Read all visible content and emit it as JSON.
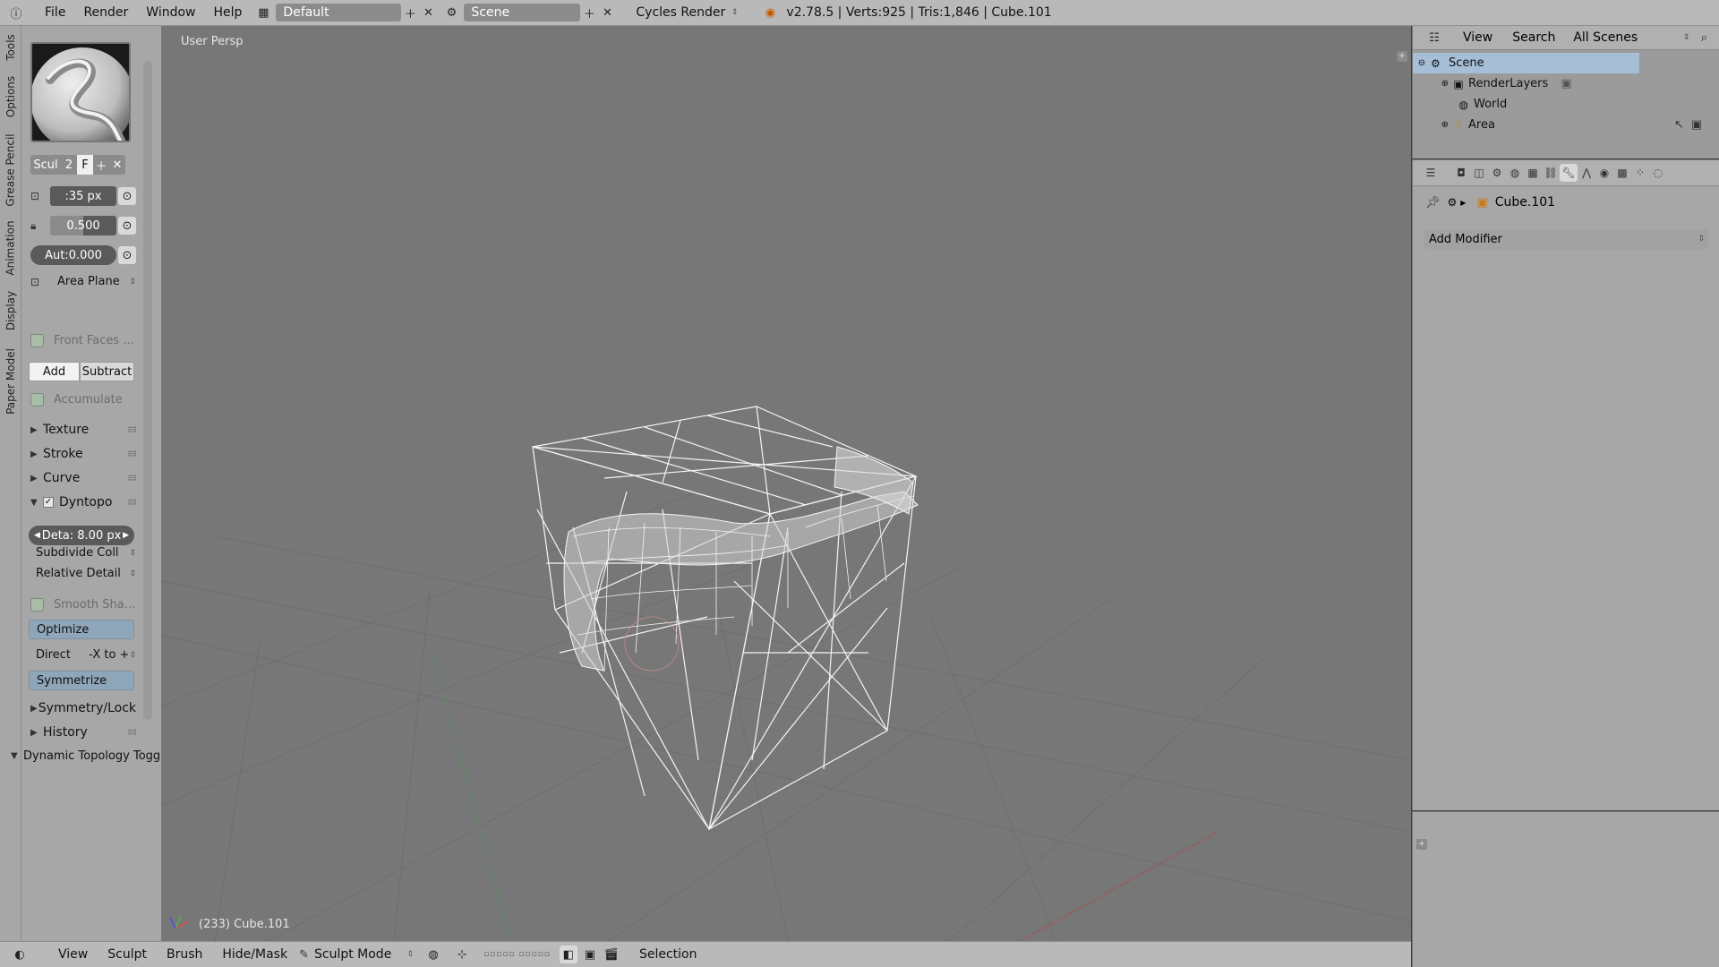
{
  "topbar": {
    "menus": [
      "File",
      "Render",
      "Window",
      "Help"
    ],
    "layout": "Default",
    "scene": "Scene",
    "engine": "Cycles Render",
    "stats": "v2.78.5 | Verts:925 | Tris:1,846 | Cube.101"
  },
  "tabs": [
    "Tools",
    "Options",
    "Grease Pencil",
    "Animation",
    "Display",
    "Paper Model"
  ],
  "shelf": {
    "brush_name": "Scul",
    "brush_users": "2",
    "brush_fake": "F",
    "radius": ":35 px",
    "strength": "0.500",
    "autosmooth": "Aut:0.000",
    "sculpt_plane": "Area Plane",
    "front_faces": "Front Faces ...",
    "add": "Add",
    "subtract": "Subtract",
    "accumulate": "Accumulate",
    "panels": [
      "Texture",
      "Stroke",
      "Curve"
    ],
    "dyntopo": "Dyntopo",
    "detail": "Deta: 8.00 px",
    "subdivide": "Subdivide Coll",
    "relative": "Relative Detail",
    "smooth_shading": "Smooth Sha...",
    "optimize": "Optimize",
    "direction_label": "Direct",
    "direction_value": "-X to +",
    "symmetrize": "Symmetrize",
    "symmetry": "Symmetry/Lock",
    "history": "History",
    "operator": "Dynamic Topology Togg"
  },
  "viewport": {
    "view_label": "User Persp",
    "object_label": "(233) Cube.101"
  },
  "bottombar": {
    "menus": [
      "View",
      "Sculpt",
      "Brush",
      "Hide/Mask"
    ],
    "mode": "Sculpt Mode",
    "selection": "Selection"
  },
  "outliner": {
    "view": "View",
    "search": "Search",
    "filter": "All Scenes",
    "items": [
      "Scene",
      "RenderLayers",
      "World",
      "Area"
    ]
  },
  "properties": {
    "object": "Cube.101",
    "add_modifier": "Add Modifier"
  }
}
